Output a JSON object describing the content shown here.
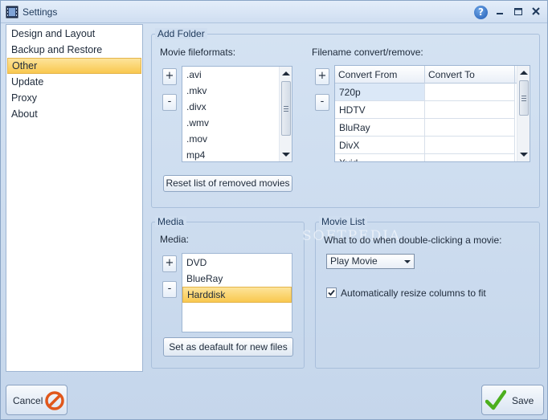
{
  "window": {
    "title": "Settings",
    "help_symbol": "?"
  },
  "nav": {
    "items": [
      {
        "label": "Design and Layout",
        "selected": false
      },
      {
        "label": "Backup and Restore",
        "selected": false
      },
      {
        "label": "Other",
        "selected": true
      },
      {
        "label": "Update",
        "selected": false
      },
      {
        "label": "Proxy",
        "selected": false
      },
      {
        "label": "About",
        "selected": false
      }
    ]
  },
  "add_folder": {
    "title": "Add Folder",
    "movie_formats_label": "Movie fileformats:",
    "add_symbol": "+",
    "remove_symbol": "-",
    "formats": [
      ".avi",
      ".mkv",
      ".divx",
      ".wmv",
      ".mov",
      "mp4"
    ],
    "reset_button": "Reset list of removed movies",
    "convert_label": "Filename convert/remove:",
    "convert_columns": [
      "Convert From",
      "Convert To"
    ],
    "convert_rows": [
      {
        "from": "720p",
        "to": ""
      },
      {
        "from": "HDTV",
        "to": ""
      },
      {
        "from": "BluRay",
        "to": ""
      },
      {
        "from": "DivX",
        "to": ""
      },
      {
        "from": "Xvid",
        "to": ""
      }
    ]
  },
  "media": {
    "title": "Media",
    "label": "Media:",
    "add_symbol": "+",
    "remove_symbol": "-",
    "items": [
      {
        "label": "DVD",
        "selected": false
      },
      {
        "label": "BlueRay",
        "selected": false
      },
      {
        "label": "Harddisk",
        "selected": true
      }
    ],
    "default_button": "Set as deafault for new files"
  },
  "movie_list": {
    "title": "Movie List",
    "double_click_label": "What to do when double-clicking  a movie:",
    "double_click_value": "Play Movie",
    "auto_resize_label": "Automatically resize columns to fit",
    "auto_resize_checked": true
  },
  "footer": {
    "cancel_label": "Cancel",
    "save_label": "Save"
  },
  "watermark": "SOFTPEDIA",
  "colors": {
    "selection": "#f9c84f",
    "accent": "#1f5bb5",
    "cancel_icon": "#e0571b",
    "save_icon": "#4caf1e"
  }
}
